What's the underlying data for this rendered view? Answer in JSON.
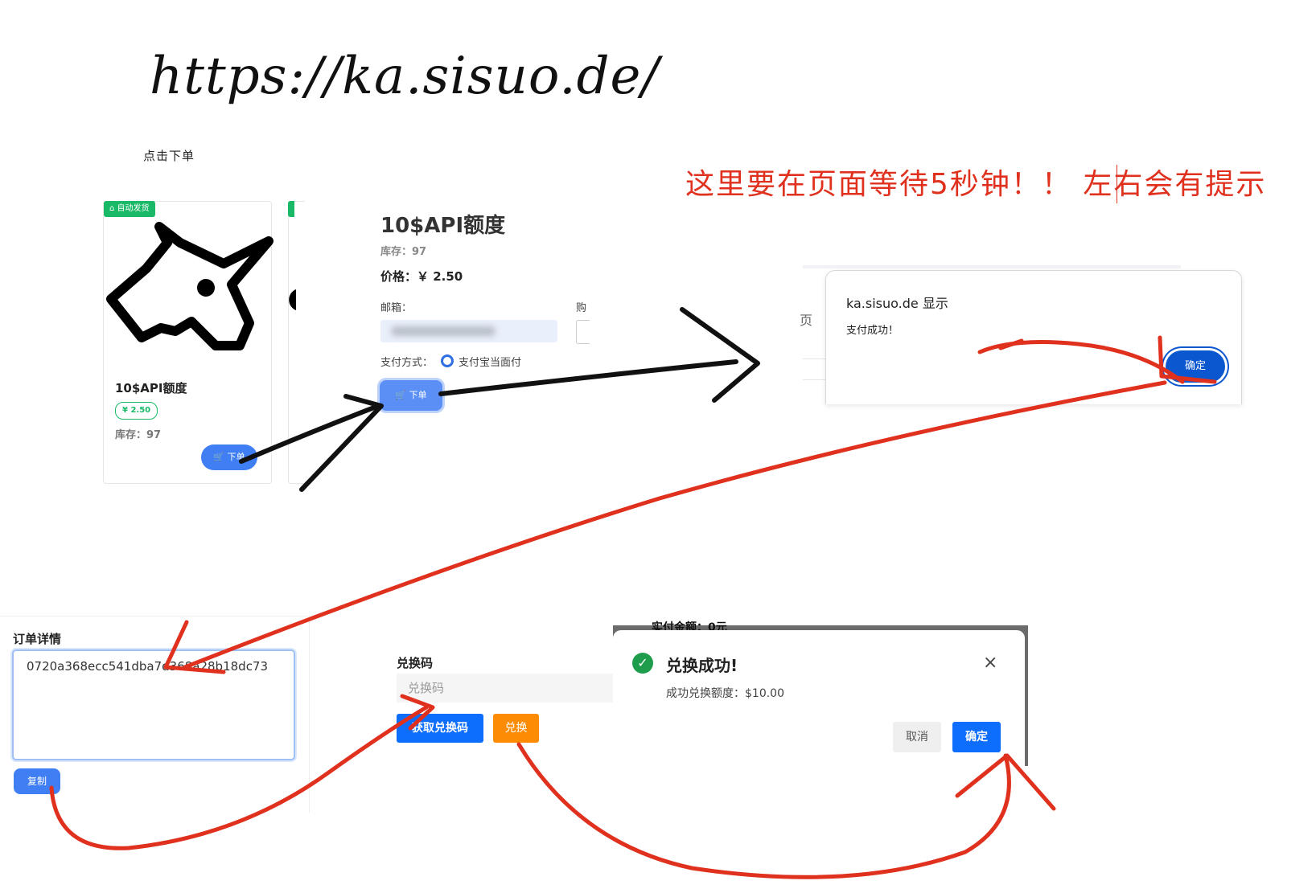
{
  "header": {
    "url": "https://ka.sisuo.de/",
    "step_click_order": "点击下单",
    "wait_notice": "这里要在页面等待5秒钟！！ 左右会有提示"
  },
  "product_card": {
    "tag": "⌂ 自动发货",
    "name": "10$API额度",
    "price": "¥ 2.50",
    "stock": "库存：97",
    "order_button": "🛒 下单"
  },
  "product_detail": {
    "title": "10$API额度",
    "stock": "库存：97",
    "price": "价格：￥ 2.50",
    "email_label": "邮箱：",
    "buy_label": "购",
    "payment_label": "支付方式：",
    "payment_option": "支付宝当面付",
    "order_button": "🛒 下单"
  },
  "browser_alert": {
    "page_char": "页",
    "title": "ka.sisuo.de 显示",
    "message": "支付成功！",
    "ok_button": "确定"
  },
  "order_detail": {
    "label": "订单详情",
    "code": "0720a368ecc541dba7d368a28b18dc73",
    "copy_button": "复制"
  },
  "redeem": {
    "label": "兑换码",
    "placeholder": "兑换码",
    "get_button": "获取兑换码",
    "redeem_button": "兑换"
  },
  "success_dialog": {
    "backdrop_text": "实付金额：0元",
    "title": "兑换成功!",
    "message": "成功兑换额度：$10.00",
    "close_icon": "×",
    "cancel_button": "取消",
    "ok_button": "确定"
  },
  "colors": {
    "arrow_black": "#111111",
    "arrow_red": "#e0301e",
    "accent_blue": "#0d6efd",
    "success_green": "#1e9e4c",
    "orange": "#fd8c04"
  }
}
